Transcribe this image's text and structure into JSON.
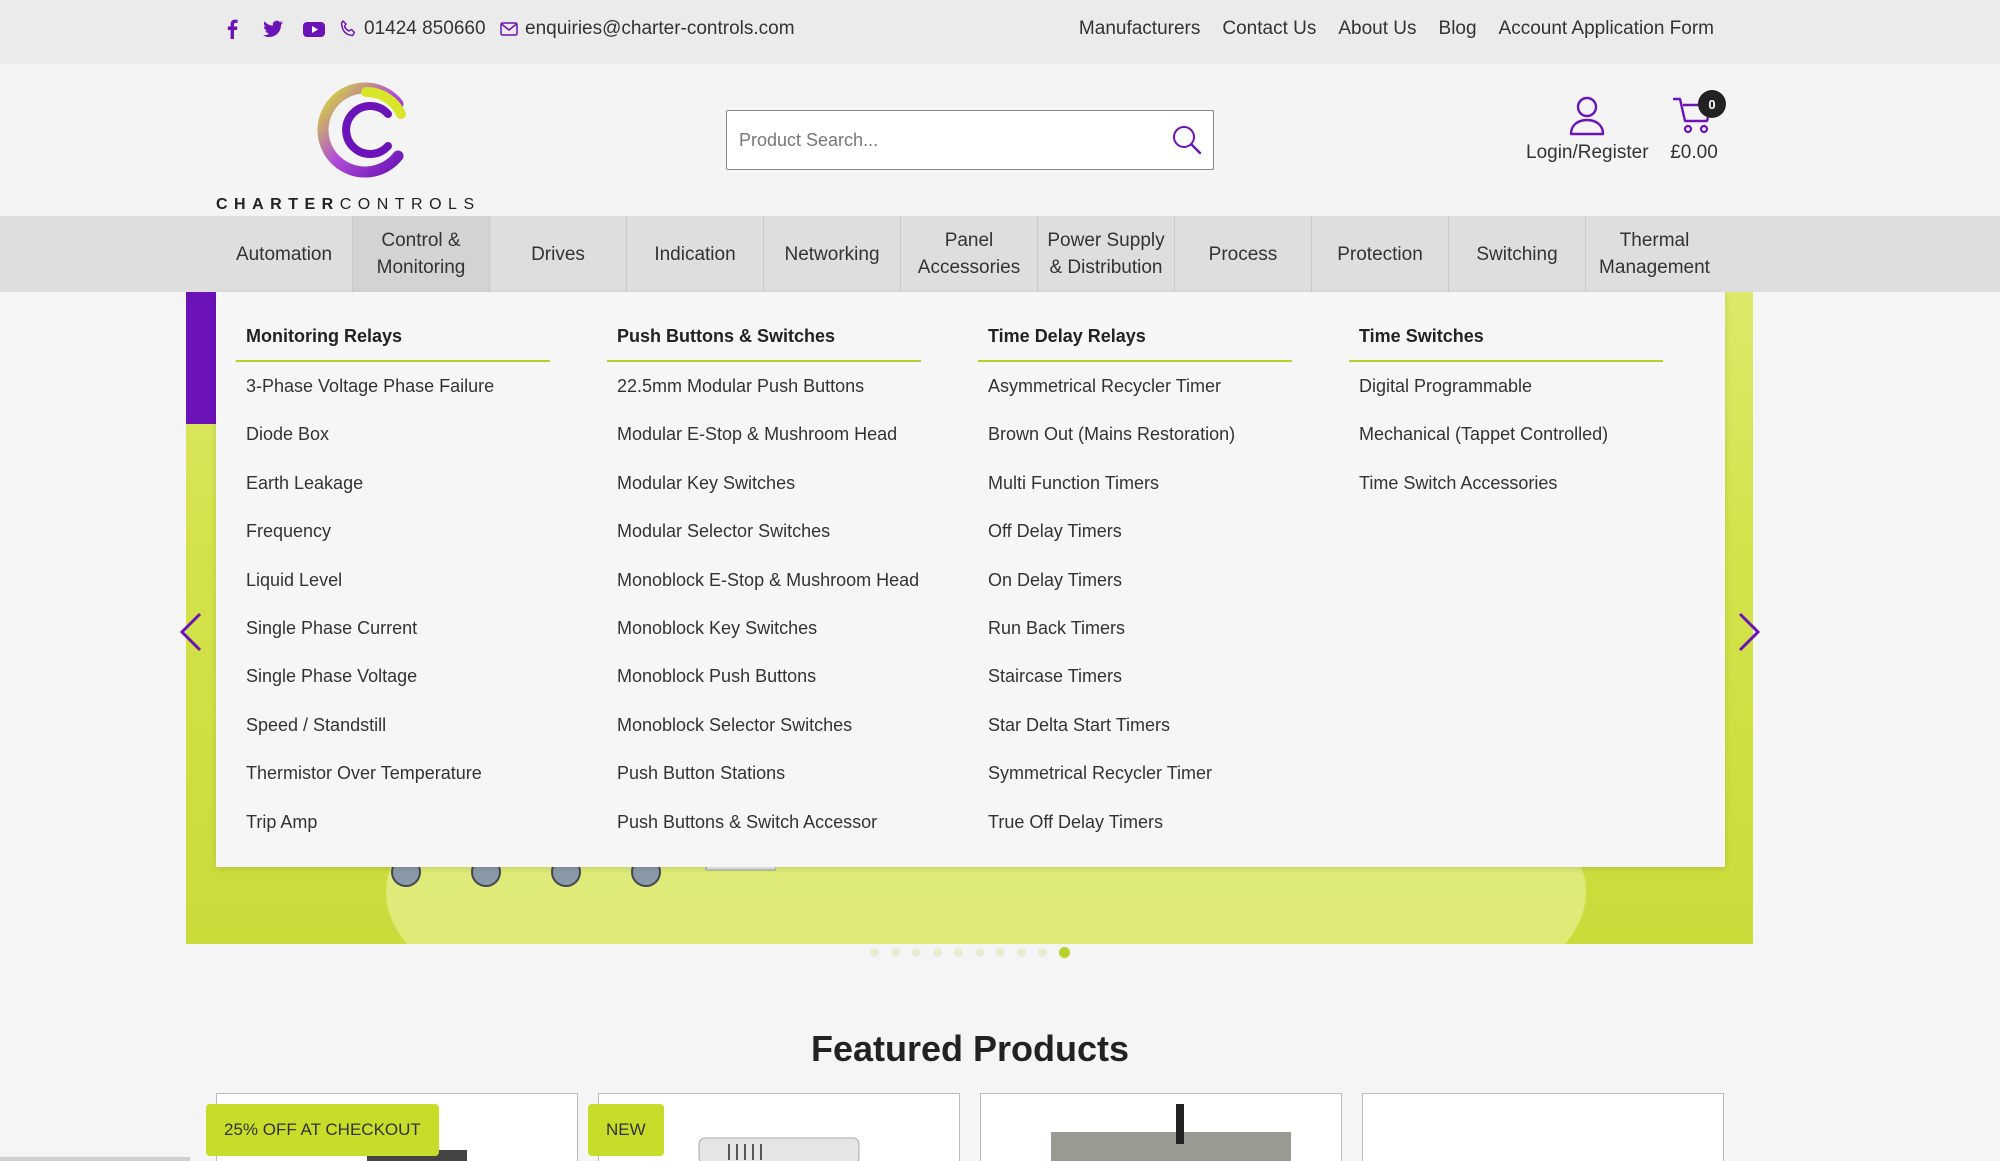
{
  "topbar": {
    "phone": "01424 850660",
    "email": "enquiries@charter-controls.com",
    "links": [
      "Manufacturers",
      "Contact Us",
      "About Us",
      "Blog",
      "Account Application Form"
    ]
  },
  "header": {
    "logo_word1": "CHARTER",
    "logo_word2": "CONTROLS",
    "search_placeholder": "Product Search...",
    "account_label": "Login/Register",
    "cart_total": "£0.00",
    "cart_count": "0"
  },
  "categories": [
    {
      "label": "Automation"
    },
    {
      "label": "Control & Monitoring",
      "l1": "Control &",
      "l2": "Monitoring"
    },
    {
      "label": "Drives"
    },
    {
      "label": "Indication"
    },
    {
      "label": "Networking"
    },
    {
      "label": "Panel Accessories",
      "l1": "Panel",
      "l2": "Accessories"
    },
    {
      "label": "Power Supply & Distribution",
      "l1": "Power Supply",
      "l2": "& Distribution"
    },
    {
      "label": "Process"
    },
    {
      "label": "Protection"
    },
    {
      "label": "Switching"
    },
    {
      "label": "Thermal Management",
      "l1": "Thermal",
      "l2": "Management"
    }
  ],
  "mega_menu": [
    {
      "heading": "Monitoring Relays",
      "items": [
        "3-Phase Voltage Phase Failure",
        "Diode Box",
        "Earth Leakage",
        "Frequency",
        "Liquid Level",
        "Single Phase Current",
        "Single Phase Voltage",
        "Speed / Standstill",
        "Thermistor Over Temperature",
        "Trip Amp"
      ]
    },
    {
      "heading": "Push Buttons & Switches",
      "items": [
        "22.5mm Modular Push Buttons",
        "Modular E-Stop & Mushroom Head",
        "Modular Key Switches",
        "Modular Selector Switches",
        "Monoblock E-Stop & Mushroom Head",
        "Monoblock Key Switches",
        "Monoblock Push Buttons",
        "Monoblock Selector Switches",
        "Push Button Stations",
        "Push Buttons & Switch Accessor"
      ]
    },
    {
      "heading": "Time Delay Relays",
      "items": [
        "Asymmetrical Recycler Timer",
        "Brown Out (Mains Restoration)",
        "Multi Function Timers",
        "Off Delay Timers",
        "On Delay Timers",
        "Run Back Timers",
        "Staircase Timers",
        "Star Delta Start Timers",
        "Symmetrical Recycler Timer",
        "True Off Delay Timers"
      ]
    },
    {
      "heading": "Time Switches",
      "items": [
        "Digital Programmable",
        "Mechanical (Tappet Controlled)",
        "Time Switch Accessories"
      ]
    }
  ],
  "slider": {
    "dot_count": 10,
    "active_dot": 10
  },
  "featured": {
    "title": "Featured Products",
    "badges": [
      "25% OFF AT CHECKOUT",
      "NEW"
    ]
  },
  "colors": {
    "brand_purple": "#6b13b8",
    "brand_lime": "#c8dc2a"
  }
}
